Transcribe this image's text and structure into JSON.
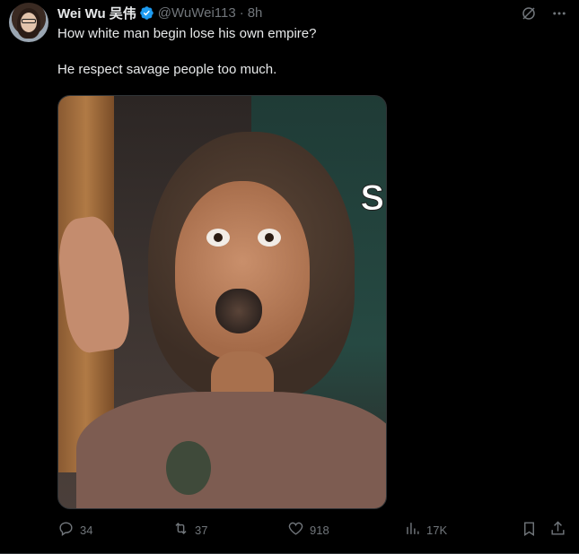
{
  "tweet": {
    "author": {
      "name": "Wei Wu 吴伟",
      "handle": "@WuWei113",
      "separator": "·",
      "time": "8h"
    },
    "text_lines": [
      "How white man begin lose his own empire?",
      "He respect savage people too much."
    ],
    "media": {
      "overlay_text": "S"
    },
    "actions": {
      "replies": "34",
      "reposts": "37",
      "likes": "918",
      "views": "17K"
    }
  },
  "icons": {
    "verified": "verified-badge-icon",
    "grok": "grok-icon",
    "more": "more-icon",
    "reply": "reply-icon",
    "repost": "repost-icon",
    "like": "like-icon",
    "views": "views-icon",
    "bookmark": "bookmark-icon",
    "share": "share-icon"
  },
  "colors": {
    "background": "#000000",
    "text": "#e7e9ea",
    "muted": "#71767b",
    "verified": "#1d9bf0"
  }
}
